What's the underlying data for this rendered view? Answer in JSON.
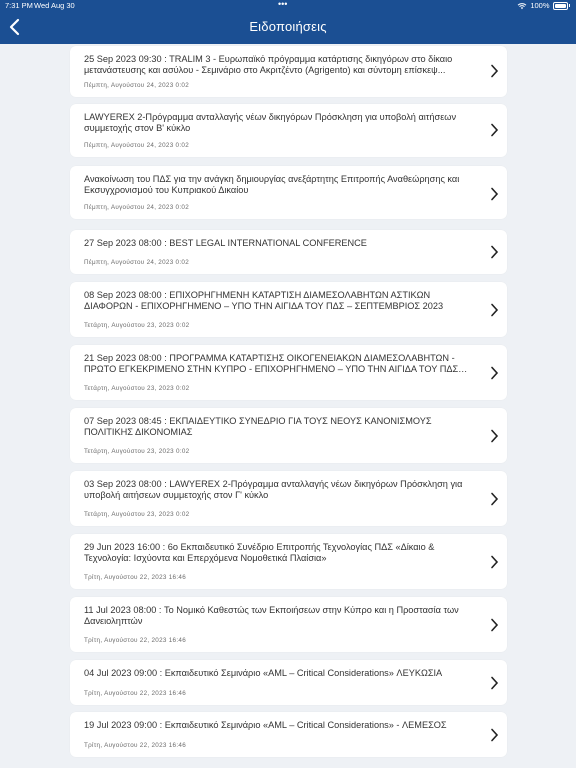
{
  "status": {
    "time": "7:31 PM",
    "date": "Wed Aug 30",
    "battery": "100%"
  },
  "header": {
    "title": "Ειδοποιήσεις",
    "back_icon": "chevron-left-icon"
  },
  "notifications": [
    {
      "text": "25 Sep 2023 09:30 : TRALIM 3 - Ευρωπαϊκό πρόγραμμα κατάρτισης δικηγόρων στο δίκαιο μετανάστευσης και ασύλου - Σεμινάριο στο Ακριτζέντο (Agrigento) και σύντομη επίσκεψ...",
      "date": "Πέμπτη, Αυγούστου 24, 2023 0:02"
    },
    {
      "text": "LAWYEREX 2-Πρόγραμμα ανταλλαγής νέων δικηγόρων Πρόσκληση για υποβολή αιτήσεων συμμετοχής στον Β' κύκλο",
      "date": "Πέμπτη, Αυγούστου 24, 2023 0:02"
    },
    {
      "text": "Ανακοίνωση του ΠΔΣ για την ανάγκη δημιουργίας ανεξάρτητης Επιτροπής Αναθεώρησης και Εκσυγχρονισμού του Κυπριακού Δικαίου",
      "date": "Πέμπτη, Αυγούστου 24, 2023 0:02"
    },
    {
      "text": "27 Sep 2023 08:00 : BEST LEGAL INTERNATIONAL CONFERENCE",
      "date": "Πέμπτη, Αυγούστου 24, 2023 0:02"
    },
    {
      "text": "08 Sep 2023 08:00 : ΕΠΙΧΟΡΗΓΗΜΕΝΗ ΚΑΤΑΡΤΙΣΗ ΔΙΑΜΕΣΟΛΑΒΗΤΩΝ ΑΣΤΙΚΩΝ ΔΙΑΦΟΡΩΝ - ΕΠΙΧΟΡΗΓΗΜΕΝΟ – ΥΠΟ ΤΗΝ ΑΙΓΙΔΑ ΤΟΥ ΠΔΣ – ΣΕΠΤΕΜΒΡΙΟΣ 2023",
      "date": "Τετάρτη, Αυγούστου 23, 2023 0:02"
    },
    {
      "text": "21 Sep 2023 08:00 : ΠΡΟΓΡΑΜΜΑ ΚΑΤΑΡΤΙΣΗΣ ΟΙΚΟΓΕΝΕΙΑΚΩΝ ΔΙΑΜΕΣΟΛΑΒΗΤΩΝ - ΠΡΩΤΟ ΕΓΚΕΚΡΙΜΕΝΟ ΣΤΗΝ ΚΥΠΡΟ - ΕΠΙΧΟΡΗΓΗΜΕΝΟ – ΥΠΟ ΤΗΝ ΑΙΓΙΔΑ ΤΟΥ ΠΔΣ –...",
      "date": "Τετάρτη, Αυγούστου 23, 2023 0:02"
    },
    {
      "text": "07 Sep 2023 08:45 : ΕΚΠΑΙΔΕΥΤΙΚΟ ΣΥΝΕΔΡΙΟ ΓΙΑ ΤΟΥΣ ΝΕΟΥΣ ΚΑΝΟΝΙΣΜΟΥΣ ΠΟΛΙΤΙΚΗΣ ΔΙΚΟΝΟΜΙΑΣ",
      "date": "Τετάρτη, Αυγούστου 23, 2023 0:02"
    },
    {
      "text": "03 Sep 2023 08:00 : LAWYEREX 2-Πρόγραμμα ανταλλαγής νέων δικηγόρων Πρόσκληση για υποβολή αιτήσεων συμμετοχής στον Γ' κύκλο",
      "date": "Τετάρτη, Αυγούστου 23, 2023 0:02"
    },
    {
      "text": "29 Jun 2023 16:00 : 6ο Εκπαιδευτικό Συνέδριο Επιτροπής Τεχνολογίας ΠΔΣ «Δίκαιο & Τεχνολογία: Ισχύοντα και Επερχόμενα Νομοθετικά Πλαίσια»",
      "date": "Τρίτη, Αυγούστου 22, 2023 16:46"
    },
    {
      "text": "11 Jul 2023 08:00 : Το Νομικό Καθεστώς των Εκποιήσεων στην Κύπρο και η Προστασία των Δανειοληπτών",
      "date": "Τρίτη, Αυγούστου 22, 2023 16:46"
    },
    {
      "text": "04 Jul 2023 09:00 : Εκπαιδευτικό Σεμινάριο «AML – Critical Considerations» ΛΕΥΚΩΣΙΑ",
      "date": "Τρίτη, Αυγούστου 22, 2023 16:46"
    },
    {
      "text": "19 Jul 2023 09:00 : Εκπαιδευτικό Σεμινάριο «AML – Critical Considerations» - ΛΕΜΕΣΟΣ",
      "date": "Τρίτη, Αυγούστου 22, 2023 16:46"
    }
  ]
}
